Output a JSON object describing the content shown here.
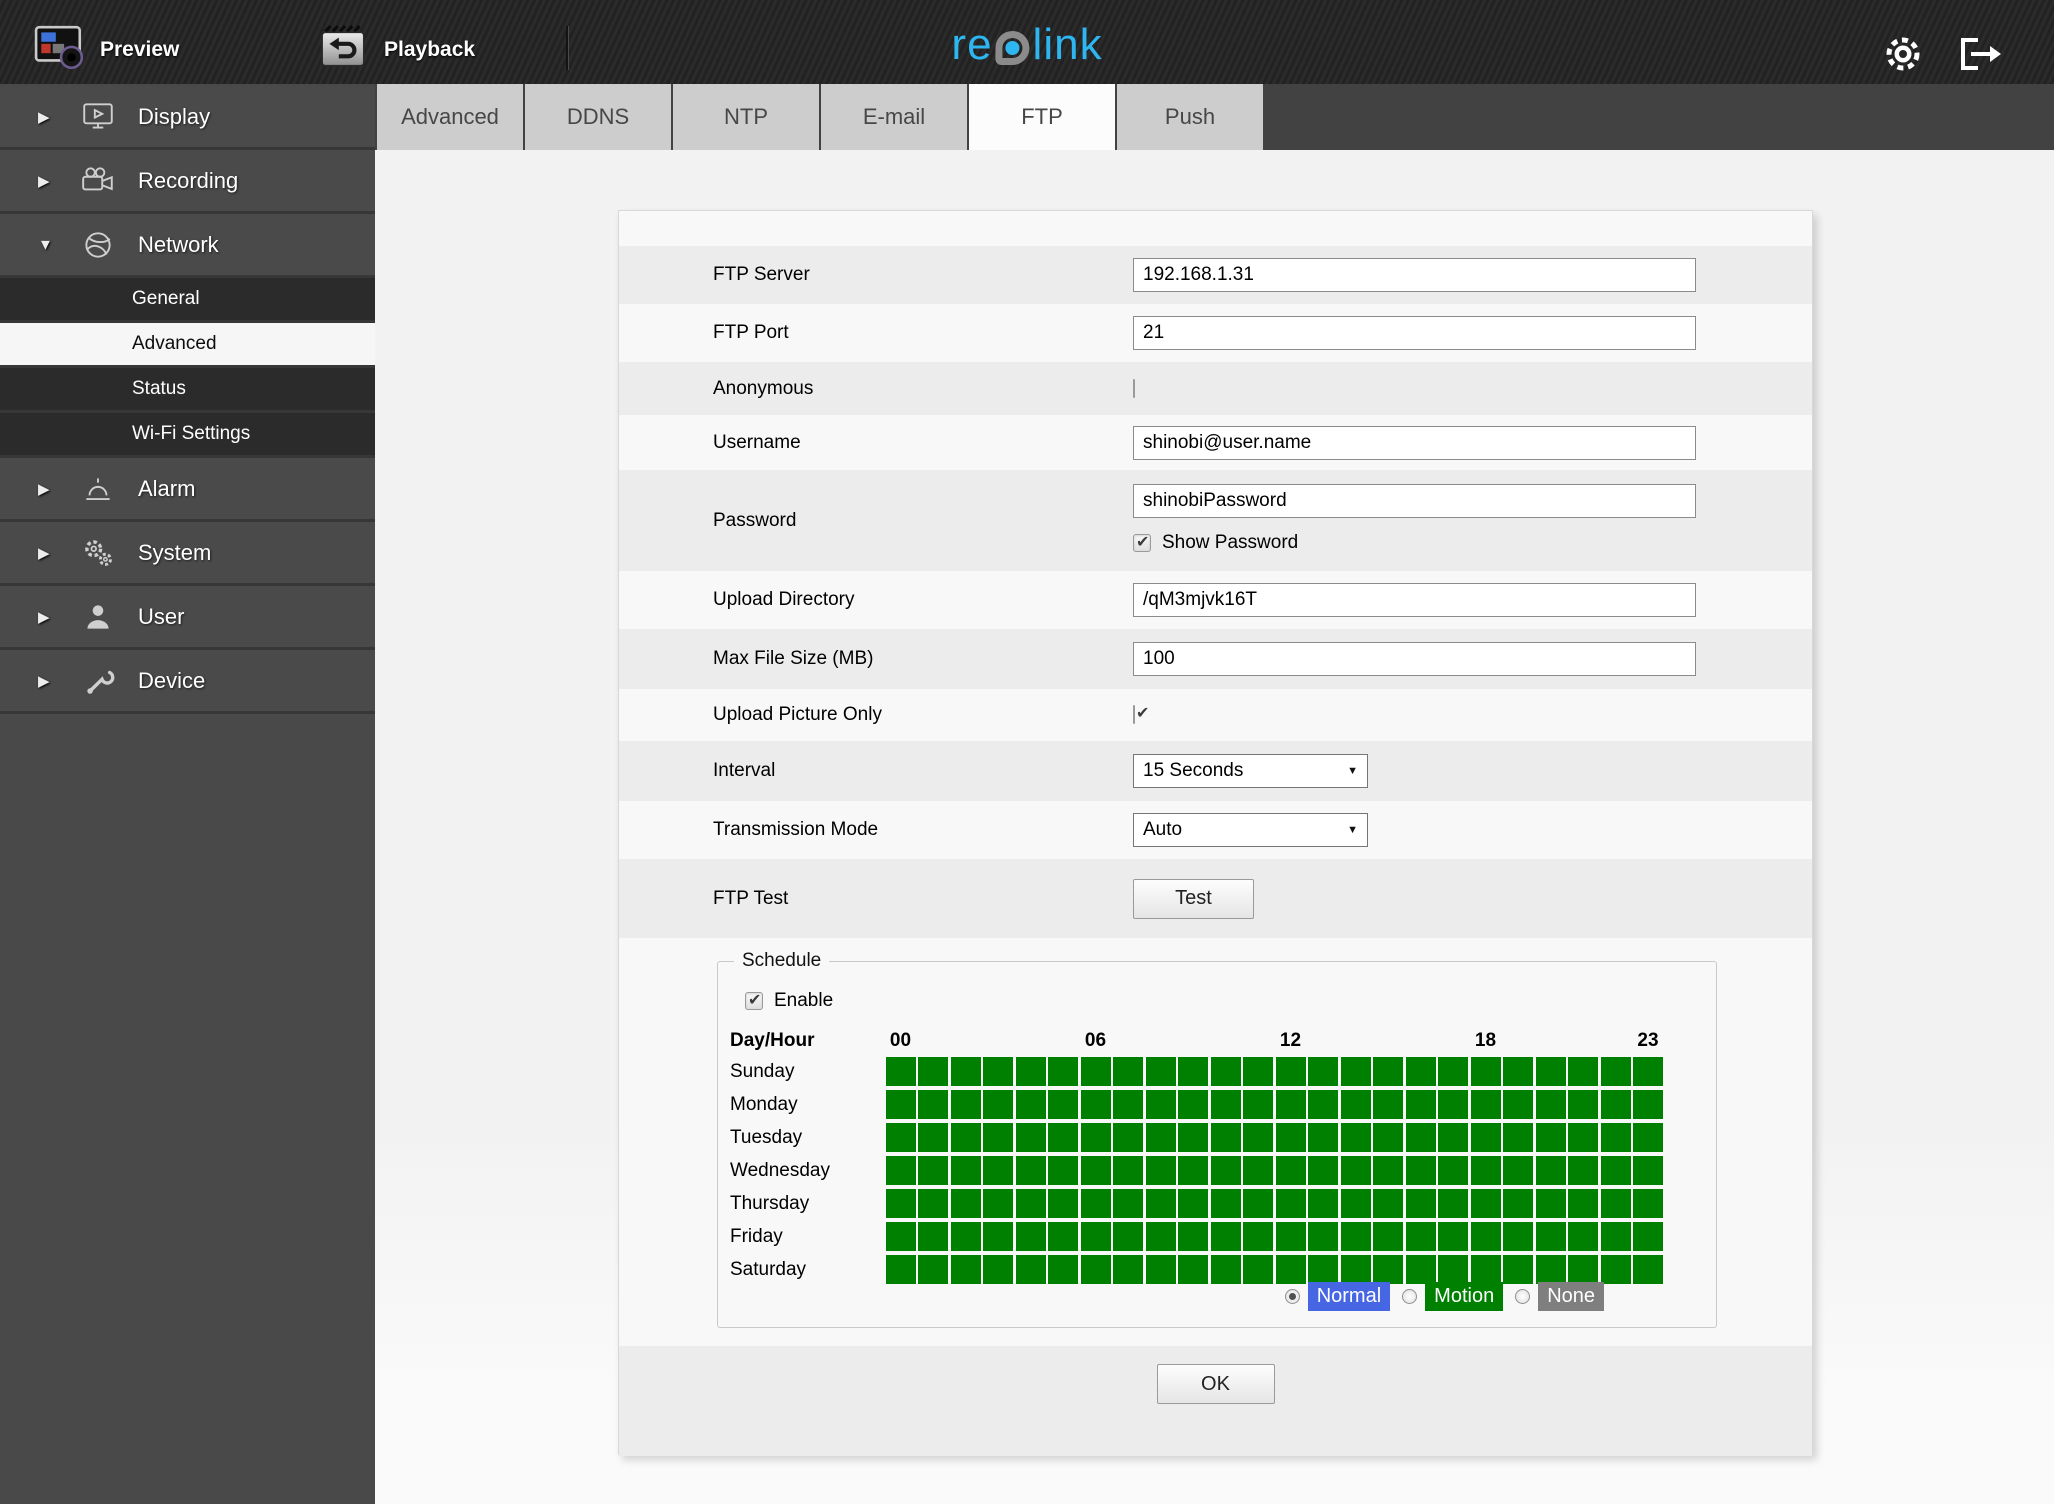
{
  "topbar": {
    "preview": {
      "label": "Preview",
      "icon": "preview-icon"
    },
    "playback": {
      "label": "Playback",
      "icon": "playback-icon"
    },
    "logo": {
      "pre": "re",
      "post": "link",
      "color": "#2eb6f0"
    },
    "actions": [
      {
        "icon": "settings-gear-icon"
      },
      {
        "icon": "logout-icon"
      }
    ]
  },
  "tabs": [
    {
      "label": "Advanced",
      "active": false
    },
    {
      "label": "DDNS",
      "active": false
    },
    {
      "label": "NTP",
      "active": false
    },
    {
      "label": "E-mail",
      "active": false
    },
    {
      "label": "FTP",
      "active": true
    },
    {
      "label": "Push",
      "active": false
    }
  ],
  "sidebar": {
    "items": [
      {
        "label": "Display",
        "icon": "display-icon",
        "level": "top",
        "caret": "right",
        "selected": false
      },
      {
        "label": "Recording",
        "icon": "recording-icon",
        "level": "top",
        "caret": "right",
        "selected": false
      },
      {
        "label": "Network",
        "icon": "network-icon",
        "level": "top",
        "caret": "down",
        "selected": false
      },
      {
        "label": "General",
        "level": "sub",
        "selected": false
      },
      {
        "label": "Advanced",
        "level": "sub",
        "selected": true
      },
      {
        "label": "Status",
        "level": "sub",
        "selected": false
      },
      {
        "label": "Wi-Fi Settings",
        "level": "sub",
        "selected": false
      },
      {
        "label": "Alarm",
        "icon": "alarm-icon",
        "level": "top",
        "caret": "right",
        "selected": false
      },
      {
        "label": "System",
        "icon": "system-icon",
        "level": "top",
        "caret": "right",
        "selected": false
      },
      {
        "label": "User",
        "icon": "user-icon",
        "level": "top",
        "caret": "right",
        "selected": false
      },
      {
        "label": "Device",
        "icon": "device-icon",
        "level": "top",
        "caret": "right",
        "selected": false
      }
    ]
  },
  "form": {
    "rows": [
      {
        "label": "FTP Server",
        "type": "text",
        "value": "192.168.1.31",
        "shade": "dark"
      },
      {
        "label": "FTP Port",
        "type": "text",
        "value": "21",
        "shade": "light"
      },
      {
        "label": "Anonymous",
        "type": "checkbox",
        "checked": false,
        "shade": "dark"
      },
      {
        "label": "Username",
        "type": "text",
        "value": "shinobi@user.name",
        "shade": "light"
      },
      {
        "label": "Password",
        "type": "password",
        "value": "shinobiPassword",
        "extra_label": "Show Password",
        "extra_checked": true,
        "shade": "dark"
      },
      {
        "label": "Upload Directory",
        "type": "text",
        "value": "/qM3mjvk16T",
        "shade": "light"
      },
      {
        "label": "Max File Size (MB)",
        "type": "text",
        "value": "100",
        "shade": "dark"
      },
      {
        "label": "Upload Picture Only",
        "type": "checkbox",
        "checked": true,
        "shade": "light"
      },
      {
        "label": "Interval",
        "type": "select",
        "value": "15 Seconds",
        "shade": "dark"
      },
      {
        "label": "Transmission Mode",
        "type": "select",
        "value": "Auto",
        "shade": "light"
      },
      {
        "label": "FTP Test",
        "type": "button",
        "value": "Test",
        "shade": "dark"
      }
    ]
  },
  "schedule": {
    "legend": "Schedule",
    "enable_label": "Enable",
    "enabled": true,
    "header_label": "Day/Hour",
    "hour_labels": [
      {
        "text": "00",
        "col": 0
      },
      {
        "text": "06",
        "col": 6
      },
      {
        "text": "12",
        "col": 12
      },
      {
        "text": "18",
        "col": 18
      },
      {
        "text": "23",
        "col": 23
      }
    ],
    "days": [
      "Sunday",
      "Monday",
      "Tuesday",
      "Wednesday",
      "Thursday",
      "Friday",
      "Saturday"
    ],
    "hours_per_day": 24,
    "grid_fill": {
      "state": "all-selected",
      "color": "#008000"
    },
    "modes": [
      {
        "label": "Normal",
        "color": "#4666e3",
        "selected": true
      },
      {
        "label": "Motion",
        "color": "#008000",
        "selected": false
      },
      {
        "label": "None",
        "color": "#7f7f7f",
        "selected": false
      }
    ]
  },
  "ok_label": "OK",
  "colors": {
    "accent_blue": "#2eb6f0",
    "schedule_green": "#008000",
    "normal_blue": "#4666e3",
    "none_gray": "#7f7f7f"
  }
}
